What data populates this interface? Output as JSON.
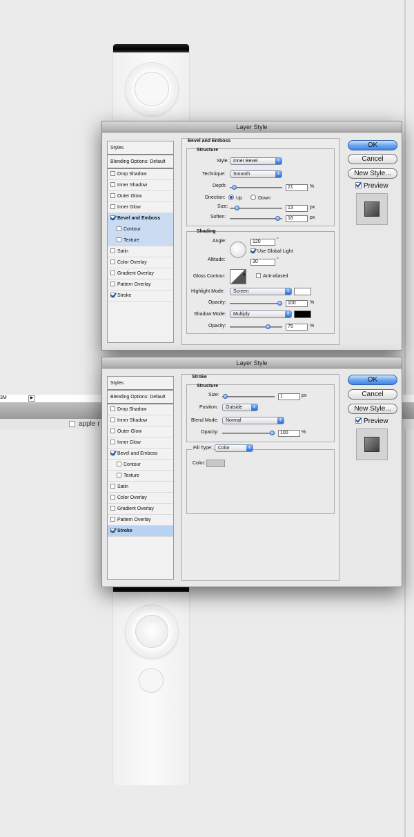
{
  "background": {
    "toolbar_text": "3M",
    "layer_label": "apple r"
  },
  "dialog1": {
    "title": "Layer Style",
    "styles_header": "Styles",
    "blending": "Blending Options: Default",
    "items": [
      {
        "label": "Drop Shadow",
        "checked": false
      },
      {
        "label": "Inner Shadow",
        "checked": false
      },
      {
        "label": "Outer Glow",
        "checked": false
      },
      {
        "label": "Inner Glow",
        "checked": false
      },
      {
        "label": "Bevel and Emboss",
        "checked": true,
        "selected": true
      },
      {
        "label": "Contour",
        "checked": false,
        "sub": true
      },
      {
        "label": "Texture",
        "checked": false,
        "sub": true
      },
      {
        "label": "Satin",
        "checked": false
      },
      {
        "label": "Color Overlay",
        "checked": false
      },
      {
        "label": "Gradient Overlay",
        "checked": false
      },
      {
        "label": "Pattern Overlay",
        "checked": false
      },
      {
        "label": "Stroke",
        "checked": true
      }
    ],
    "section_title": "Bevel and Emboss",
    "structure": {
      "title": "Structure",
      "style_label": "Style:",
      "style_value": "Inner Bevel",
      "technique_label": "Technique:",
      "technique_value": "Smooth",
      "depth_label": "Depth:",
      "depth_value": "21",
      "depth_unit": "%",
      "depth_level": 0.05,
      "direction_label": "Direction:",
      "up_label": "Up",
      "down_label": "Down",
      "size_label": "Size:",
      "size_value": "13",
      "size_unit": "px",
      "size_level": 0.1,
      "soften_label": "Soften:",
      "soften_value": "16",
      "soften_unit": "px",
      "soften_level": 0.95
    },
    "shading": {
      "title": "Shading",
      "angle_label": "Angle:",
      "angle_value": "120",
      "angle_unit": "°",
      "global_light_label": "Use Global Light",
      "altitude_label": "Altitude:",
      "altitude_value": "30",
      "altitude_unit": "°",
      "gloss_label": "Gloss Contour:",
      "antialiased_label": "Anti-aliased",
      "highlight_label": "Highlight Mode:",
      "highlight_value": "Screen",
      "highlight_color": "#ffffff",
      "opacity1_label": "Opacity:",
      "opacity1_value": "100",
      "opacity1_unit": "%",
      "opacity1_level": 1.0,
      "shadow_label": "Shadow Mode:",
      "shadow_value": "Multiply",
      "shadow_color": "#000000",
      "opacity2_label": "Opacity:",
      "opacity2_value": "75",
      "opacity2_unit": "%",
      "opacity2_level": 0.75
    },
    "buttons": {
      "ok": "OK",
      "cancel": "Cancel",
      "new_style": "New Style...",
      "preview": "Preview"
    }
  },
  "dialog2": {
    "title": "Layer Style",
    "styles_header": "Styles",
    "blending": "Blending Options: Default",
    "items": [
      {
        "label": "Drop Shadow",
        "checked": false
      },
      {
        "label": "Inner Shadow",
        "checked": false
      },
      {
        "label": "Outer Glow",
        "checked": false
      },
      {
        "label": "Inner Glow",
        "checked": false
      },
      {
        "label": "Bevel and Emboss",
        "checked": true
      },
      {
        "label": "Contour",
        "checked": false,
        "sub": true
      },
      {
        "label": "Texture",
        "checked": false,
        "sub": true
      },
      {
        "label": "Satin",
        "checked": false
      },
      {
        "label": "Color Overlay",
        "checked": false
      },
      {
        "label": "Gradient Overlay",
        "checked": false
      },
      {
        "label": "Pattern Overlay",
        "checked": false
      },
      {
        "label": "Stroke",
        "checked": true,
        "selected": true
      }
    ],
    "section_title": "Stroke",
    "structure": {
      "title": "Structure",
      "size_label": "Size:",
      "size_value": "1",
      "size_unit": "px",
      "size_level": 0.01,
      "position_label": "Position:",
      "position_value": "Outside",
      "blend_label": "Blend Mode:",
      "blend_value": "Normal",
      "opacity_label": "Opacity:",
      "opacity_value": "100",
      "opacity_unit": "%",
      "opacity_level": 1.0
    },
    "fill": {
      "type_label": "Fill Type:",
      "type_value": "Color",
      "color_label": "Color:",
      "color_value": "#c8c8c8"
    },
    "buttons": {
      "ok": "OK",
      "cancel": "Cancel",
      "new_style": "New Style...",
      "preview": "Preview"
    }
  }
}
